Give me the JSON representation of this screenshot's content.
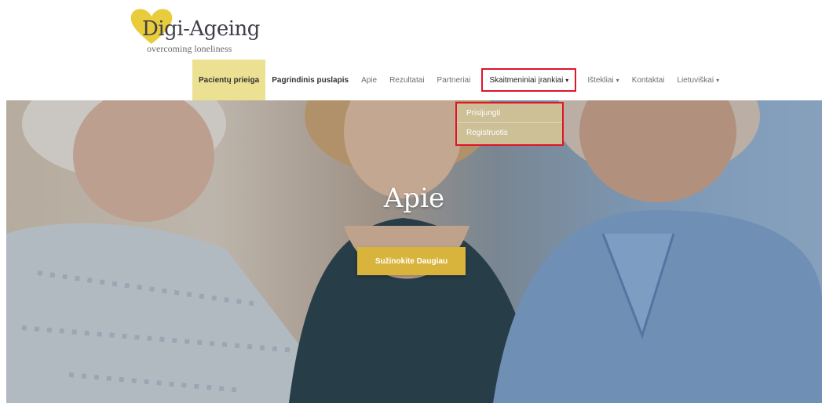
{
  "brand": {
    "title": "Digi-Ageing",
    "subtitle": "overcoming loneliness",
    "heart_color": "#e8cc3c"
  },
  "nav": {
    "items": [
      {
        "label": "Pacientų prieiga"
      },
      {
        "label": "Pagrindinis puslapis"
      },
      {
        "label": "Apie"
      },
      {
        "label": "Rezultatai"
      },
      {
        "label": "Partneriai"
      },
      {
        "label": "Skaitmeniniai įrankiai"
      },
      {
        "label": "Ištekliai"
      },
      {
        "label": "Kontaktai"
      },
      {
        "label": "Lietuviškai"
      }
    ],
    "caret": "▾"
  },
  "dropdown": {
    "items": [
      {
        "label": "Prisijungti"
      },
      {
        "label": "Registruotis"
      }
    ]
  },
  "hero": {
    "title": "Apie",
    "button_label": "Sužinokite Daugiau"
  },
  "colors": {
    "accent": "#d9b43c",
    "active_nav": "#ece092",
    "highlight": "#e0142a",
    "dropdown_bg": "#cdbf96"
  }
}
